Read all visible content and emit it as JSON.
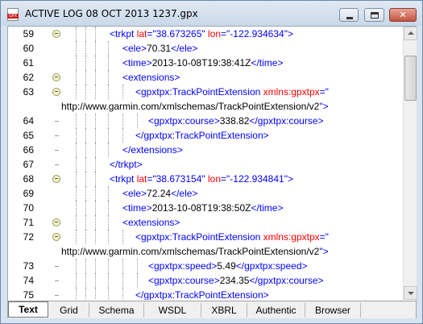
{
  "window": {
    "title": "ACTIVE LOG 08 OCT 2013 1237.gpx",
    "icon": "gpx-file-icon",
    "icon_text": "GPX",
    "close_glyph": "✕"
  },
  "lines": [
    {
      "num": "59",
      "parts": [
        [
          "t",
          "<trkpt "
        ],
        [
          "a",
          "lat"
        ],
        [
          "t",
          "=\""
        ],
        [
          "v",
          "38.673265"
        ],
        [
          "t",
          "\" "
        ],
        [
          "a",
          "lon"
        ],
        [
          "t",
          "=\""
        ],
        [
          "v",
          "-122.934634"
        ],
        [
          "t",
          "\">"
        ]
      ]
    },
    {
      "num": "60",
      "parts": [
        [
          "t",
          "<ele>"
        ],
        [
          "x",
          "70.31"
        ],
        [
          "t",
          "</ele>"
        ]
      ]
    },
    {
      "num": "61",
      "parts": [
        [
          "t",
          "<time>"
        ],
        [
          "x",
          "2013-10-08T19:38:41Z"
        ],
        [
          "t",
          "</time>"
        ]
      ]
    },
    {
      "num": "62",
      "parts": [
        [
          "t",
          "<extensions>"
        ]
      ]
    },
    {
      "num": "63",
      "parts": [
        [
          "t",
          "<gpxtpx:TrackPointExtension "
        ],
        [
          "a",
          "xmlns:gpxtpx"
        ],
        [
          "t",
          "=\""
        ]
      ]
    },
    {
      "num": "",
      "parts": [
        [
          "x",
          "http://www.garmin.com/xmlschemas/TrackPointExtension/v2"
        ],
        [
          "t",
          "\">"
        ]
      ]
    },
    {
      "num": "64",
      "parts": [
        [
          "t",
          "<gpxtpx:course>"
        ],
        [
          "x",
          "338.82"
        ],
        [
          "t",
          "</gpxtpx:course>"
        ]
      ]
    },
    {
      "num": "65",
      "parts": [
        [
          "t",
          "</gpxtpx:TrackPointExtension>"
        ]
      ]
    },
    {
      "num": "66",
      "parts": [
        [
          "t",
          "</extensions>"
        ]
      ]
    },
    {
      "num": "67",
      "parts": [
        [
          "t",
          "</trkpt>"
        ]
      ]
    },
    {
      "num": "68",
      "parts": [
        [
          "t",
          "<trkpt "
        ],
        [
          "a",
          "lat"
        ],
        [
          "t",
          "=\""
        ],
        [
          "v",
          "38.673154"
        ],
        [
          "t",
          "\" "
        ],
        [
          "a",
          "lon"
        ],
        [
          "t",
          "=\""
        ],
        [
          "v",
          "-122.934841"
        ],
        [
          "t",
          "\">"
        ]
      ]
    },
    {
      "num": "69",
      "parts": [
        [
          "t",
          "<ele>"
        ],
        [
          "x",
          "72.24"
        ],
        [
          "t",
          "</ele>"
        ]
      ]
    },
    {
      "num": "70",
      "parts": [
        [
          "t",
          "<time>"
        ],
        [
          "x",
          "2013-10-08T19:38:50Z"
        ],
        [
          "t",
          "</time>"
        ]
      ]
    },
    {
      "num": "71",
      "parts": [
        [
          "t",
          "<extensions>"
        ]
      ]
    },
    {
      "num": "72",
      "parts": [
        [
          "t",
          "<gpxtpx:TrackPointExtension "
        ],
        [
          "a",
          "xmlns:gpxtpx"
        ],
        [
          "t",
          "=\""
        ]
      ]
    },
    {
      "num": "",
      "parts": [
        [
          "x",
          "http://www.garmin.com/xmlschemas/TrackPointExtension/v2"
        ],
        [
          "t",
          "\">"
        ]
      ]
    },
    {
      "num": "73",
      "parts": [
        [
          "t",
          "<gpxtpx:speed>"
        ],
        [
          "x",
          "5.49"
        ],
        [
          "t",
          "</gpxtpx:speed>"
        ]
      ]
    },
    {
      "num": "74",
      "parts": [
        [
          "t",
          "<gpxtpx:course>"
        ],
        [
          "x",
          "234.35"
        ],
        [
          "t",
          "</gpxtpx:course>"
        ]
      ]
    },
    {
      "num": "75",
      "parts": [
        [
          "t",
          "</gpxtpx:TrackPointExtension>"
        ]
      ]
    },
    {
      "num": "76",
      "parts": [
        [
          "t",
          "</extensions>"
        ]
      ]
    },
    {
      "num": "77",
      "parts": [
        [
          "t",
          "</trkpt>"
        ]
      ]
    }
  ],
  "tabs": [
    "Text",
    "Grid",
    "Schema",
    "WSDL",
    "XBRL",
    "Authentic",
    "Browser"
  ],
  "active_tab": "Text",
  "colors": {
    "tag": "#0000ff",
    "attribute": "#ff0000",
    "text": "#000000",
    "titlebar": "#d7e3ef"
  }
}
